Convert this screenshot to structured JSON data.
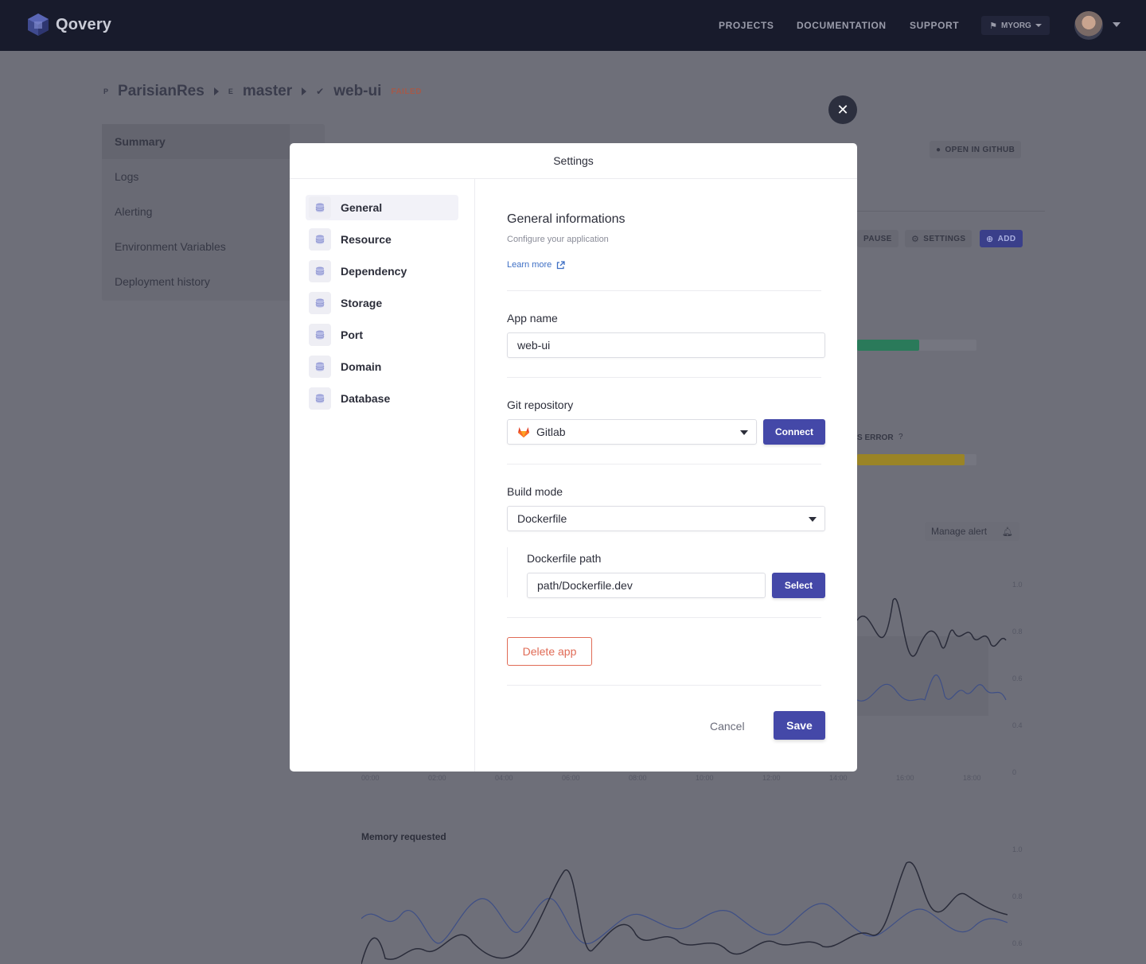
{
  "app": {
    "logo_text": "Qovery",
    "nav": [
      "PROJECTS",
      "DOCUMENTATION",
      "SUPPORT"
    ],
    "org_label": "MYORG"
  },
  "breadcrumb": {
    "project": "ParisianRes",
    "project_mini": "P",
    "environment": "master",
    "environment_mini": "E",
    "application": "web-ui",
    "status": "FAILED"
  },
  "background": {
    "side_menu": [
      "Summary",
      "Logs",
      "Alerting",
      "Environment Variables",
      "Deployment history"
    ],
    "open_github": "OPEN IN GITHUB",
    "actions": {
      "pause": "PAUSE",
      "settings": "SETTINGS",
      "add": "ADD"
    },
    "error_label": "S ERROR",
    "manage_alert": "Manage alert",
    "y_ticks": [
      "1.0",
      "0.8",
      "0.6",
      "0.4",
      "0"
    ],
    "x_ticks": [
      "00:00",
      "02:00",
      "04:00",
      "06:00",
      "08:00",
      "10:00",
      "12:00",
      "14:00",
      "16:00",
      "18:00"
    ],
    "memory_title": "Memory requested",
    "memory_y_ticks": [
      "1.0",
      "0.8",
      "0.6"
    ]
  },
  "modal": {
    "title": "Settings",
    "menu": [
      "General",
      "Resource",
      "Dependency",
      "Storage",
      "Port",
      "Domain",
      "Database"
    ],
    "active_menu": "General",
    "section_title": "General informations",
    "section_subtitle": "Configure your application",
    "learn_more": "Learn more",
    "app_name_label": "App name",
    "app_name_value": "web-ui",
    "git_label": "Git repository",
    "git_value": "Gitlab",
    "connect_label": "Connect",
    "build_label": "Build mode",
    "build_value": "Dockerfile",
    "dockerfile_label": "Dockerfile path",
    "dockerfile_value": "path/Dockerfile.dev",
    "select_label": "Select",
    "delete_label": "Delete app",
    "cancel_label": "Cancel",
    "save_label": "Save",
    "close_symbol": "✕"
  },
  "colors": {
    "primary": "#4448a8",
    "danger": "#e06b56",
    "link": "#3e6fc4",
    "topbar": "#181b2c"
  }
}
